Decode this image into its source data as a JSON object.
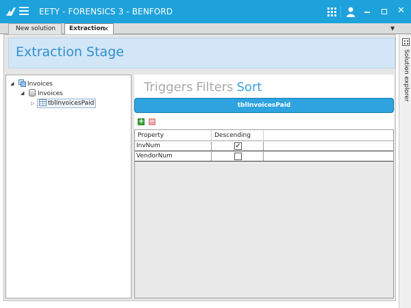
{
  "app": {
    "title": "EETY - FORENSICS 3 - BENFORD",
    "icons": [
      "logo-icon",
      "menu-icon",
      "apps-grid-icon",
      "user-icon",
      "minimize-icon",
      "maximize-icon",
      "close-icon"
    ],
    "accent_color": "#1ea2db"
  },
  "tabs": [
    {
      "label": "New solution",
      "active": false
    },
    {
      "label": "Extraction",
      "active": true,
      "close": "×"
    }
  ],
  "side_panel": {
    "label": "Solution explorer"
  },
  "stage": {
    "title": "Extraction Stage"
  },
  "tree": {
    "root": {
      "label": "Invoices",
      "expander": "◢"
    },
    "child": {
      "label": "Invoices",
      "expander": "◢"
    },
    "leaf": {
      "label": "tblInvoicesPaid",
      "expander": "▷"
    }
  },
  "sort_panel": {
    "nav": [
      "Triggers",
      "Filters",
      "Sort"
    ],
    "active_nav": "Sort",
    "table_name": "tblInvoicesPaid",
    "add_label": "+",
    "remove_label": "−",
    "columns": [
      "Property",
      "Descending"
    ],
    "rows": [
      {
        "property": "InvNum",
        "descending": true
      },
      {
        "property": "VendorNum",
        "descending": false
      }
    ]
  }
}
